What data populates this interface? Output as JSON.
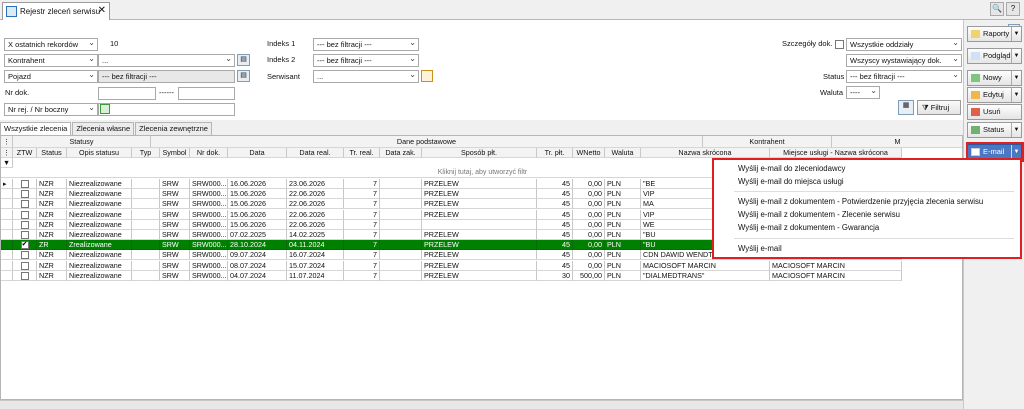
{
  "tab": {
    "title": "Rejestr zleceń serwisu",
    "close": "✕"
  },
  "top_icons": {
    "zoom": "🔍",
    "help": "?"
  },
  "filters": {
    "records_mode": "X ostatnich rekordów",
    "records_count": "10",
    "kontrahent_label": "Kontrahent",
    "kontrahent_value": "...",
    "pojazd_label": "Pojazd",
    "pojazd_value": "--- bez filtracji ---",
    "nr_dok_label": "Nr dok.",
    "nr_dok_separator": "------",
    "nr_rej_label": "Nr rej. / Nr boczny",
    "indeks1_label": "Indeks 1",
    "indeks1_value": "--- bez filtracji ---",
    "indeks2_label": "Indeks 2",
    "indeks2_value": "--- bez filtracji ---",
    "serwisant_label": "Serwisant",
    "serwisant_value": "...",
    "szczegoly_label": "Szczegóły dok.",
    "oddzialy_value": "Wszystkie oddziały",
    "wystawiajacy_value": "Wszyscy wystawiający dok.",
    "status_label": "Status",
    "status_value": "--- bez filtracji ---",
    "waluta_label": "Waluta",
    "waluta_value": "----",
    "filtruj_label": "Filtruj"
  },
  "subtabs": [
    "Wszystkie zlecenia",
    "Zlecenia własne",
    "Zlecenia zewnętrzne"
  ],
  "grid": {
    "groups": [
      "Statusy",
      "Dane podstawowe",
      "Kontrahent",
      "M"
    ],
    "columns": [
      "ZTW",
      "Status",
      "Opis statusu",
      "Typ",
      "Symbol",
      "Nr dok.",
      "Data",
      "Data real.",
      "Tr. real.",
      "Data zak.",
      "Sposób płt.",
      "Tr. płt.",
      "WNetto",
      "Waluta",
      "Nazwa skrócona",
      "Miejsce usługi - Nazwa skrócona"
    ],
    "filter_hint": "Kliknij tutaj, aby utworzyć filtr",
    "rows": [
      [
        "",
        "NZR",
        "Niezrealizowane",
        "",
        "SRW",
        "SRW000...",
        "16.06.2026",
        "23.06.2026",
        "7",
        "",
        "PRZELEW",
        "45",
        "0,00",
        "PLN",
        "\"BE",
        ""
      ],
      [
        "",
        "NZR",
        "Niezrealizowane",
        "",
        "SRW",
        "SRW000...",
        "15.06.2026",
        "22.06.2026",
        "7",
        "",
        "PRZELEW",
        "45",
        "0,00",
        "PLN",
        "VIP",
        ""
      ],
      [
        "",
        "NZR",
        "Niezrealizowane",
        "",
        "SRW",
        "SRW000...",
        "15.06.2026",
        "22.06.2026",
        "7",
        "",
        "PRZELEW",
        "45",
        "0,00",
        "PLN",
        "MA",
        ""
      ],
      [
        "",
        "NZR",
        "Niezrealizowane",
        "",
        "SRW",
        "SRW000...",
        "15.06.2026",
        "22.06.2026",
        "7",
        "",
        "PRZELEW",
        "45",
        "0,00",
        "PLN",
        "VIP",
        ""
      ],
      [
        "",
        "NZR",
        "Niezrealizowane",
        "",
        "SRW",
        "SRW000...",
        "15.06.2026",
        "22.06.2026",
        "7",
        "",
        "",
        "45",
        "0,00",
        "PLN",
        "WE",
        ""
      ],
      [
        "",
        "NZR",
        "Niezrealizowane",
        "",
        "SRW",
        "SRW000...",
        "07.02.2025",
        "14.02.2025",
        "7",
        "",
        "PRZELEW",
        "45",
        "0,00",
        "PLN",
        "\"BU",
        ""
      ],
      [
        "✔",
        "ZR",
        "Zrealizowane",
        "",
        "SRW",
        "SRW000...",
        "28.10.2024",
        "04.11.2024",
        "7",
        "",
        "PRZELEW",
        "45",
        "0,00",
        "PLN",
        "\"BU",
        ""
      ],
      [
        "",
        "NZR",
        "Niezrealizowane",
        "",
        "SRW",
        "SRW000...",
        "09.07.2024",
        "16.07.2024",
        "7",
        "",
        "PRZELEW",
        "45",
        "0,00",
        "PLN",
        "CDN DAWID WENDT",
        "MACIOSOFT MARCIN"
      ],
      [
        "",
        "NZR",
        "Niezrealizowane",
        "",
        "SRW",
        "SRW000...",
        "08.07.2024",
        "15.07.2024",
        "7",
        "",
        "PRZELEW",
        "45",
        "0,00",
        "PLN",
        "MACIOSOFT MARCIN",
        "MACIOSOFT MARCIN"
      ],
      [
        "",
        "NZR",
        "Niezrealizowane",
        "",
        "SRW",
        "SRW000...",
        "04.07.2024",
        "11.07.2024",
        "7",
        "",
        "PRZELEW",
        "30",
        "500,00",
        "PLN",
        "\"DIALMEDTRANS\"",
        "MACIOSOFT MARCIN"
      ]
    ]
  },
  "side_buttons": [
    "Raporty",
    "Podgląd",
    "Nowy",
    "Edytuj",
    "Usuń",
    "Status",
    "E-mail"
  ],
  "email_menu": [
    "Wyślij e-mail do zleceniodawcy",
    "Wyślij e-mail do miejsca usługi",
    "Wyślij e-mail z dokumentem - Potwierdzenie przyjęcia zlecenia serwisu",
    "Wyślij e-mail z dokumentem - Zlecenie serwisu",
    "Wyślij e-mail z dokumentem - Gwarancja",
    "Wyślij e-mail"
  ],
  "colors": {
    "selected_row": "#008000",
    "highlight": "#e02020",
    "email_button": "#4a78c2"
  }
}
